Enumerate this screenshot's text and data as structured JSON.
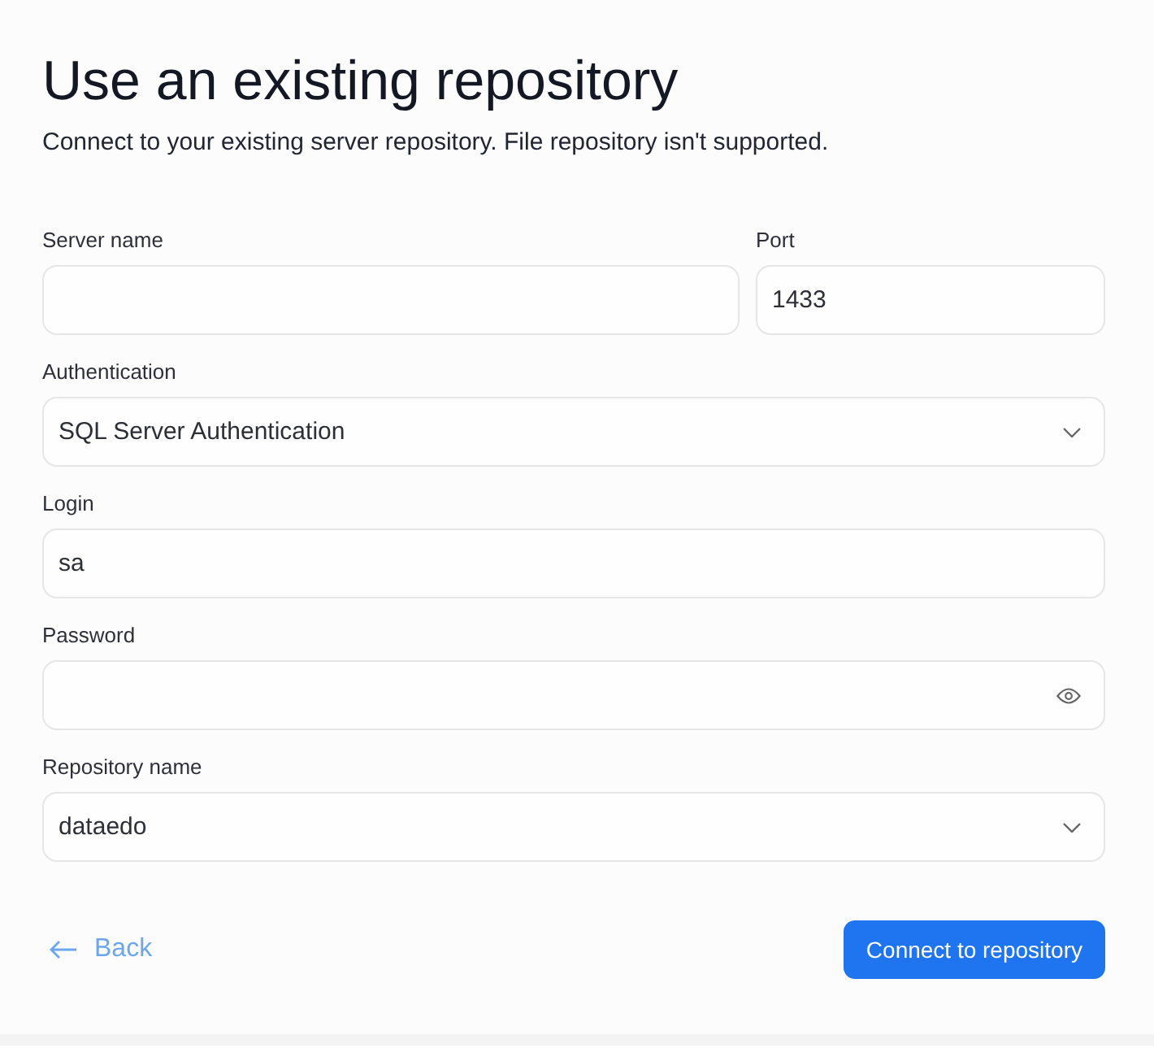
{
  "heading": {
    "title": "Use an existing repository",
    "subtitle": "Connect to your existing server repository. File repository isn't supported."
  },
  "rows": [
    [
      {
        "kind": "text",
        "label": "Server name"
      },
      {
        "kind": "text",
        "label": "Port",
        "value": "1433"
      }
    ],
    [
      {
        "kind": "select",
        "label": "Authentication",
        "value": "SQL Server Authentication"
      }
    ],
    [
      {
        "kind": "text",
        "label": "Login",
        "value": "sa"
      }
    ],
    [
      {
        "kind": "password",
        "label": "Password"
      }
    ],
    [
      {
        "kind": "select",
        "label": "Repository name",
        "value": "dataedo"
      }
    ]
  ],
  "actions": {
    "back": "Back",
    "primary": "Connect to repository"
  }
}
